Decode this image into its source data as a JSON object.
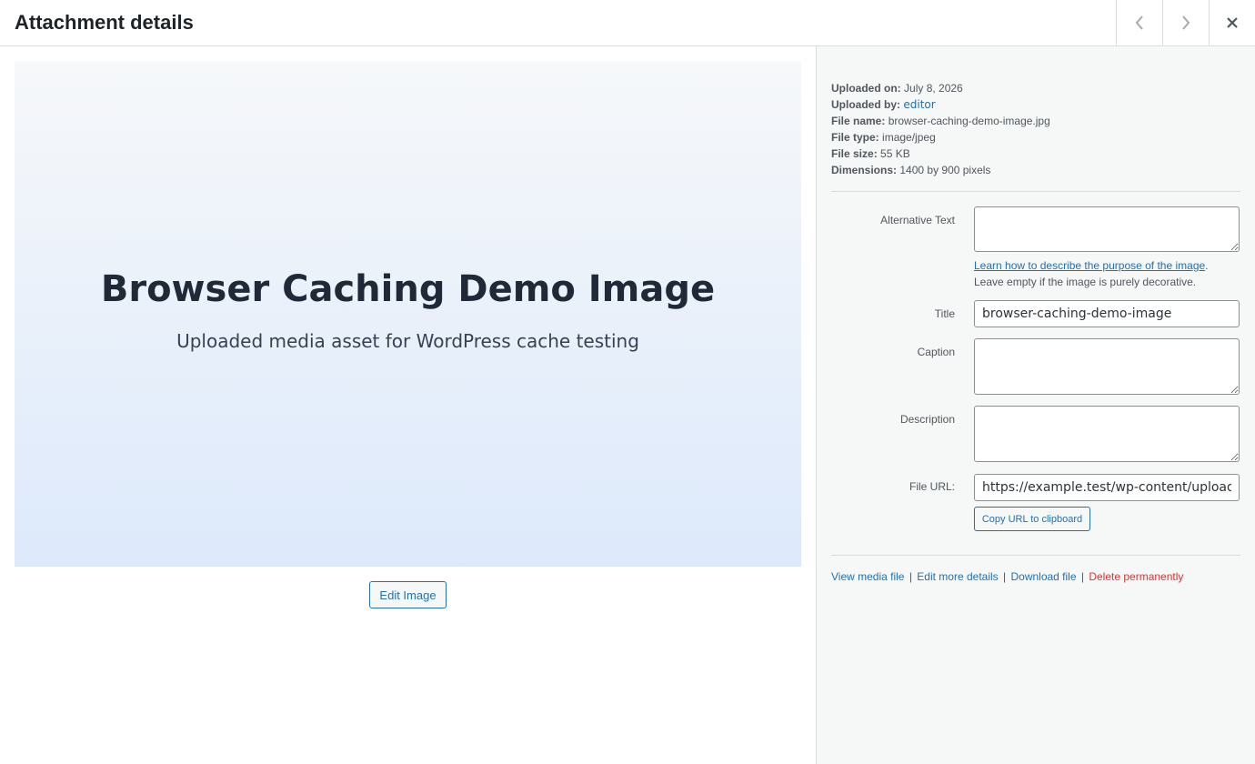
{
  "header": {
    "title": "Attachment details",
    "prev_icon": "chevron-left-icon",
    "next_icon": "chevron-right-icon",
    "close_icon": "close-icon"
  },
  "preview": {
    "image_title": "Browser Caching Demo Image",
    "image_subtitle": "Uploaded media asset for WordPress cache testing",
    "edit_button": "Edit Image"
  },
  "meta": {
    "uploaded_on_label": "Uploaded on:",
    "uploaded_on_value": "July 8, 2026",
    "uploaded_by_label": "Uploaded by:",
    "uploaded_by_value": "editor",
    "file_name_label": "File name:",
    "file_name_value": "browser-caching-demo-image.jpg",
    "file_type_label": "File type:",
    "file_type_value": "image/jpeg",
    "file_size_label": "File size:",
    "file_size_value": "55 KB",
    "dimensions_label": "Dimensions:",
    "dimensions_value": "1400 by 900 pixels"
  },
  "fields": {
    "alt_label": "Alternative Text",
    "alt_value": "",
    "alt_help_link": "Learn how to describe the purpose of the image",
    "alt_help_period": ".",
    "alt_help_text": "Leave empty if the image is purely decorative.",
    "title_label": "Title",
    "title_value": "browser-caching-demo-image",
    "caption_label": "Caption",
    "caption_value": "",
    "description_label": "Description",
    "description_value": "",
    "file_url_label": "File URL:",
    "file_url_value": "https://example.test/wp-content/uploads/browser-caching-demo-image.jpg",
    "copy_button": "Copy URL to clipboard"
  },
  "actions": {
    "view": "View media file",
    "edit_more": "Edit more details",
    "download": "Download file",
    "delete": "Delete permanently",
    "separator": "|"
  },
  "colors": {
    "link": "#2271b1",
    "danger": "#d63638",
    "sidebar_bg": "#f6f7f7"
  }
}
